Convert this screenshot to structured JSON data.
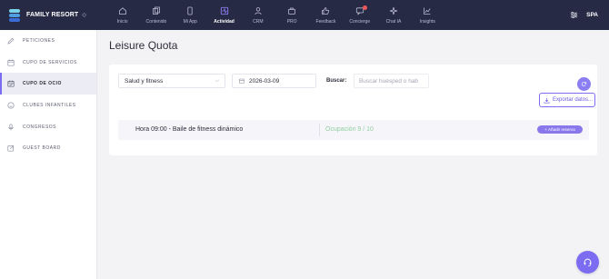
{
  "brand": {
    "name": "FAMILY RESORT",
    "chevron": "◇",
    "logo_colors": [
      "#7ad3e8",
      "#4f9fe0",
      "#3b6cd6"
    ]
  },
  "nav": {
    "items": [
      {
        "label": "Inicio",
        "icon": "home-icon"
      },
      {
        "label": "Contenido",
        "icon": "content-icon"
      },
      {
        "label": "Mi App",
        "icon": "phone-icon"
      },
      {
        "label": "Actividad",
        "icon": "activity-icon",
        "active": true
      },
      {
        "label": "CRM",
        "icon": "users-icon"
      },
      {
        "label": "PRO",
        "icon": "bag-icon"
      },
      {
        "label": "Feedback",
        "icon": "thumbs-up-icon"
      },
      {
        "label": "Concierge",
        "icon": "chat-icon",
        "badge": true
      },
      {
        "label": "Chat IA",
        "icon": "sparkle-icon"
      },
      {
        "label": "Insights",
        "icon": "chart-icon"
      }
    ]
  },
  "topright": {
    "settings_icon": "sliders-icon",
    "location": "SPA"
  },
  "sidebar": {
    "items": [
      {
        "label": "PETICIONES",
        "icon": "pencil-icon"
      },
      {
        "label": "CUPO DE SERVICIOS",
        "icon": "calendar-icon"
      },
      {
        "label": "CUPO DE OCIO",
        "icon": "calendar-check-icon",
        "active": true
      },
      {
        "label": "CLUBES INFANTILES",
        "icon": "smile-icon"
      },
      {
        "label": "CONGRESOS",
        "icon": "mic-icon"
      },
      {
        "label": "GUEST BOARD",
        "icon": "edit-icon"
      }
    ]
  },
  "main": {
    "title": "Leisure Quota",
    "filters": {
      "category": "Salud y fitness",
      "date": "2026-03-09",
      "search_label": "Buscar:",
      "search_placeholder": "Buscar huésped o hab"
    },
    "export_label": "Exportar datos...",
    "rows": [
      {
        "title": "Hora 09:00 - Baile de fitness dinámico",
        "occupancy": "Ocupación 9 / 10",
        "add_label": "+ Añadir reserva"
      }
    ]
  },
  "colors": {
    "accent": "#7b6cf2",
    "topbar": "#272a45",
    "occupancy": "#8fcf9e"
  }
}
